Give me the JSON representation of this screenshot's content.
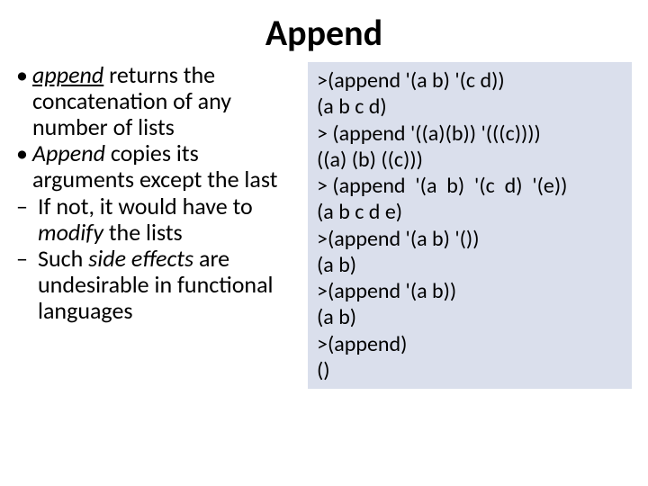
{
  "title": "Append",
  "left": {
    "b1": {
      "pre": "",
      "em1": "append",
      "mid": " returns the concatenation of any number of lists"
    },
    "b2": {
      "em1": "Append",
      "mid": " copies its arguments except the last"
    },
    "b3": {
      "pre": "If not, it would have to ",
      "em1": "modify",
      "post": " the lists"
    },
    "b4": {
      "pre": "Such ",
      "em1": "side effects",
      "post": " are undesirable in functional languages"
    }
  },
  "code": {
    "l0": ">(append '(a b) '(c d))",
    "l1": "(a b c d)",
    "l2": "> (append '((a)(b)) '(((c))))",
    "l3": "((a) (b) ((c)))",
    "l4": "> (append  '(a  b)  '(c  d)  '(e))",
    "l5": "(a b c d e)",
    "l6": ">(append '(a b) '())",
    "l7": "(a b)",
    "l8": ">(append '(a b))",
    "l9": "(a b)",
    "l10": ">(append)",
    "l11": "()"
  }
}
